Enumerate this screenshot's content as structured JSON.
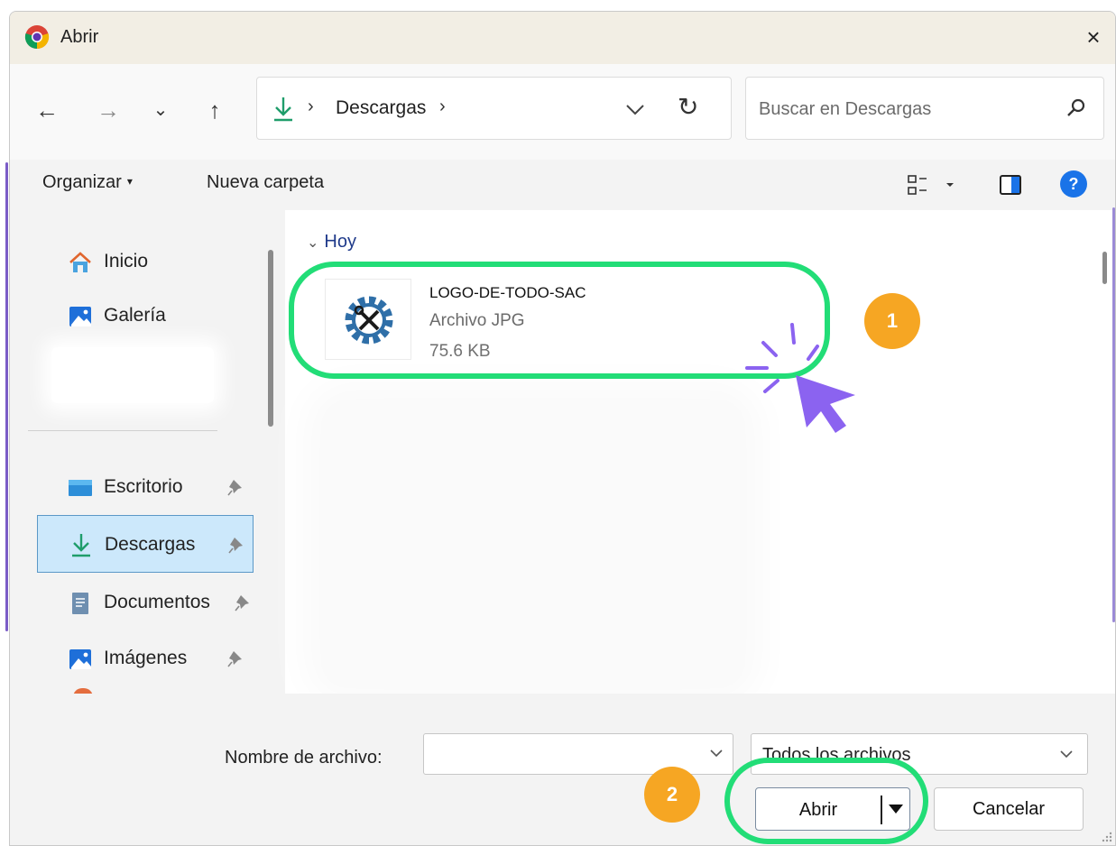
{
  "window": {
    "title": "Abrir",
    "close_glyph": "×",
    "app_icon": "chrome-icon"
  },
  "nav": {
    "back_glyph": "←",
    "forward_glyph": "→",
    "recent_glyph": "⌄",
    "up_glyph": "↑",
    "path_separator": "›",
    "current_folder": "Descargas",
    "refresh_glyph": "↻",
    "search_placeholder": "Buscar en Descargas"
  },
  "toolbar": {
    "organize_label": "Organizar",
    "caret_glyph": "▾",
    "new_folder_label": "Nueva carpeta",
    "help_glyph": "?"
  },
  "sidebar": {
    "items": [
      {
        "label": "Inicio",
        "icon": "home-icon"
      },
      {
        "label": "Galería",
        "icon": "gallery-icon"
      },
      {
        "label": "Escritorio",
        "icon": "desktop-folder-icon",
        "pinned": true
      },
      {
        "label": "Descargas",
        "icon": "download-icon",
        "pinned": true,
        "selected": true
      },
      {
        "label": "Documentos",
        "icon": "documents-icon",
        "pinned": true
      },
      {
        "label": "Imágenes",
        "icon": "pictures-icon",
        "pinned": true
      }
    ]
  },
  "content": {
    "group_chevron": "⌄",
    "group_label": "Hoy",
    "file": {
      "name": "LOGO-DE-TODO-SAC",
      "type": "Archivo JPG",
      "size": "75.6 KB",
      "thumb_icon": "gear-tools-icon"
    }
  },
  "footer": {
    "filename_label": "Nombre de archivo:",
    "filename_value": "",
    "filetype_selected": "Todos los archivos",
    "open_label": "Abrir",
    "cancel_label": "Cancelar"
  },
  "annotations": {
    "step1": "1",
    "step2": "2",
    "highlight_color": "#22dd77",
    "badge_color": "#f6a623",
    "cursor_color": "#8b63f0"
  },
  "colors": {
    "accent": "#1a73e8",
    "download_green": "#1f9d6b",
    "selected_bg": "#cce8fb"
  }
}
